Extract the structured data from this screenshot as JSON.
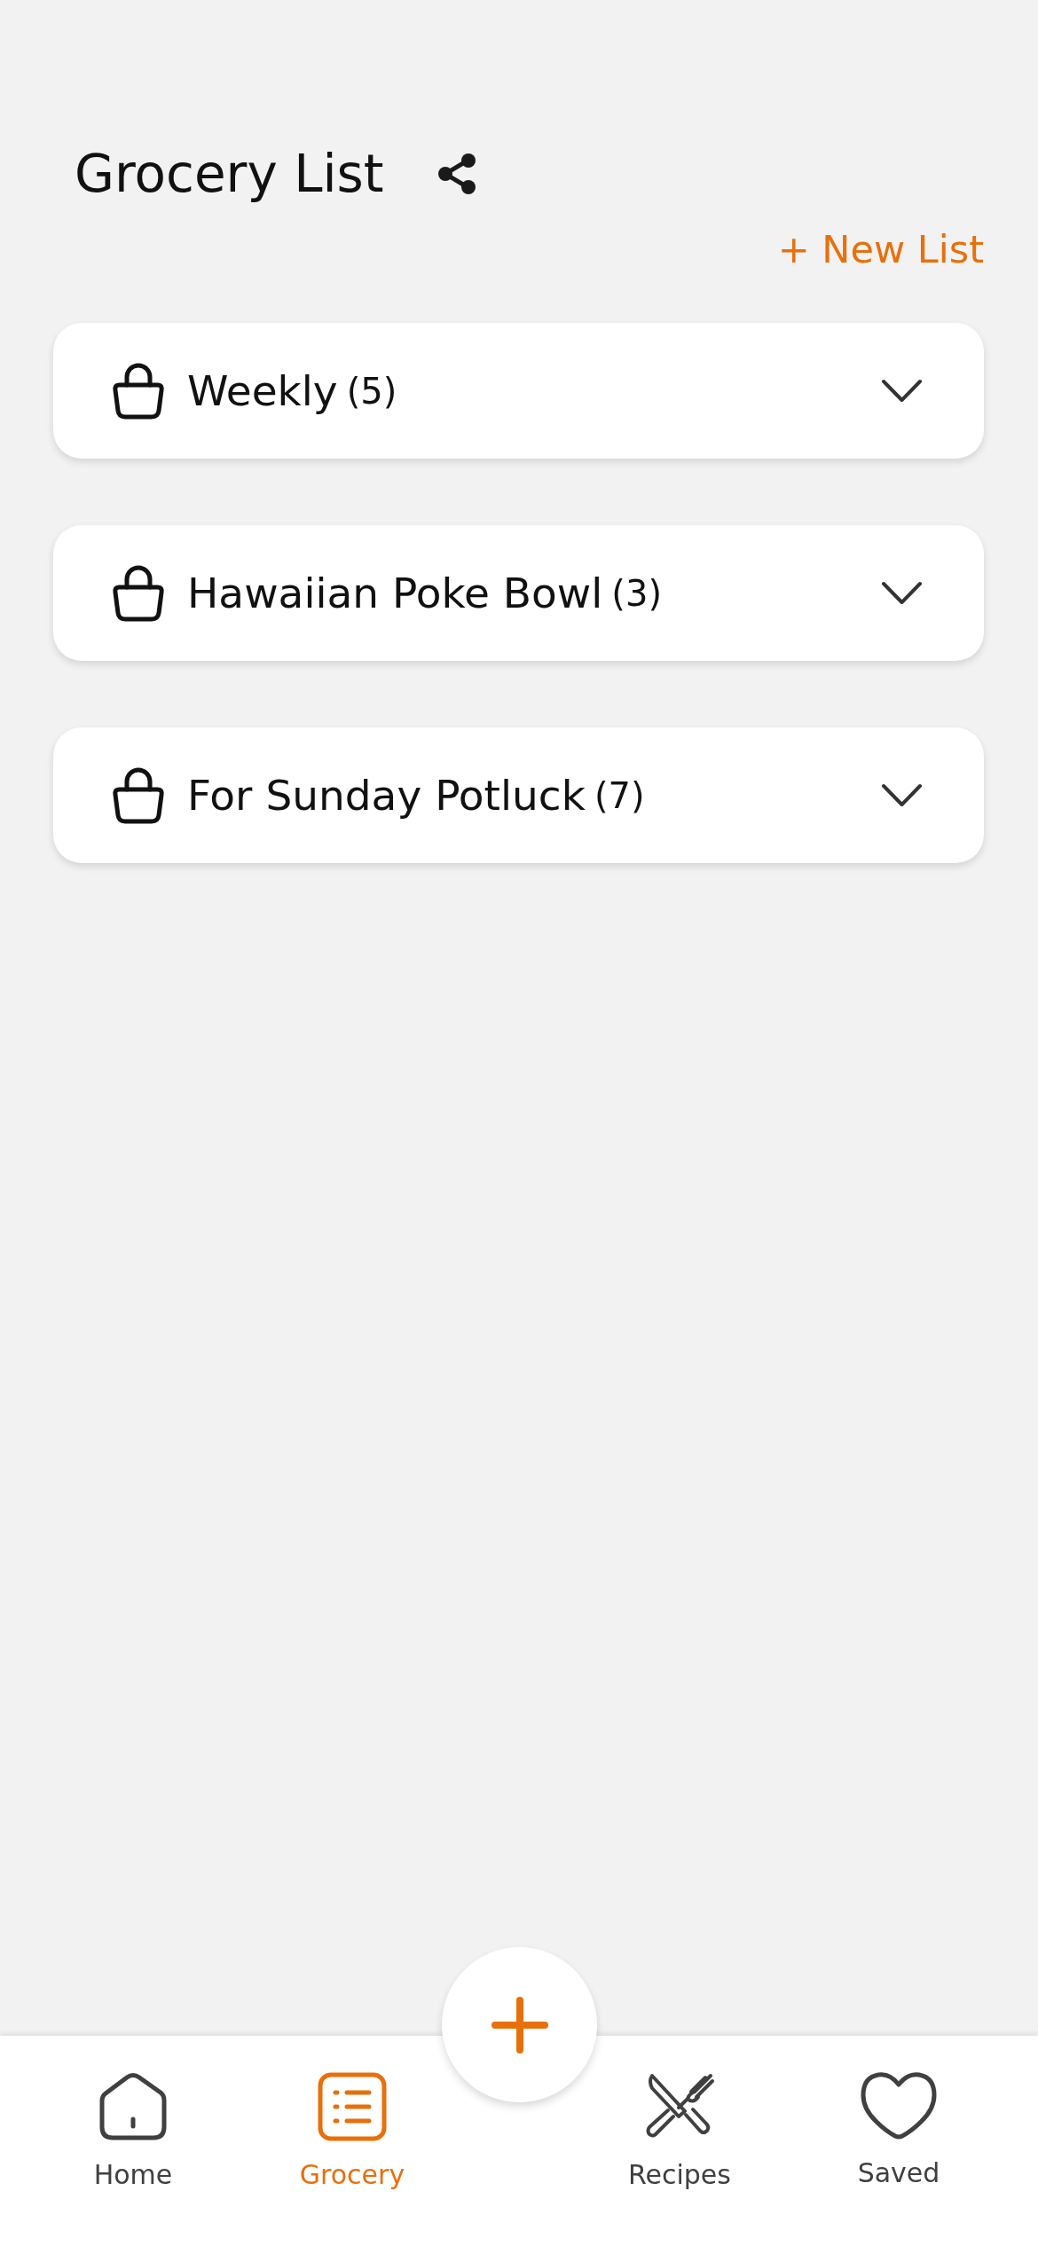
{
  "header": {
    "title": "Grocery List",
    "new_list": "+ New List"
  },
  "lists": [
    {
      "name": "Weekly",
      "count": "(5)",
      "expanded": false
    },
    {
      "name": "Hawaiian Poke Bowl",
      "count": "(3)",
      "expanded": false
    },
    {
      "name": "For Sunday Potluck",
      "count": "(7)",
      "expanded": false
    }
  ],
  "nav": [
    {
      "kind": "home",
      "label": "Home",
      "selected": false
    },
    {
      "kind": "list",
      "label": "Grocery",
      "selected": true
    },
    {
      "kind": "recipes",
      "label": "Recipes",
      "selected": false
    },
    {
      "kind": "heart",
      "label": "Saved",
      "selected": false
    }
  ]
}
